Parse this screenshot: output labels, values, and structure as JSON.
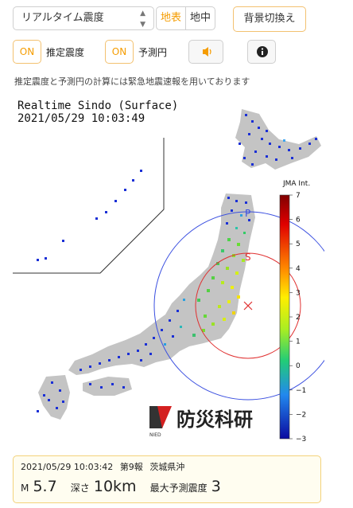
{
  "controls": {
    "select_value": "リアルタイム震度",
    "seg_surface": "地表",
    "seg_underground": "地中",
    "bg_toggle": "背景切換え",
    "est_on": "ON",
    "est_label": "推定震度",
    "pred_on": "ON",
    "pred_label": "予測円",
    "sound_icon": "speaker-icon",
    "info_icon": "info-icon"
  },
  "note": "推定震度と予測円の計算には緊急地震速報を用いております",
  "map": {
    "title": "Realtime Sindo (Surface)",
    "timestamp": "2021/05/29 10:03:49",
    "p_label": "P",
    "s_label": "S",
    "scale_title": "JMA Int.",
    "scale_ticks": [
      "7",
      "6",
      "5",
      "4",
      "3",
      "2",
      "1",
      "0",
      "−1",
      "−2",
      "−3"
    ],
    "logo_text": "防災科研",
    "logo_sub": "NIED"
  },
  "quake": {
    "time": "2021/05/29 10:03:42",
    "report": "第9報",
    "region": "茨城県沖",
    "mag_label": "M",
    "magnitude": "5.7",
    "depth_label": "深さ",
    "depth": "10km",
    "maxint_label": "最大予測震度",
    "max_intensity": "3"
  }
}
